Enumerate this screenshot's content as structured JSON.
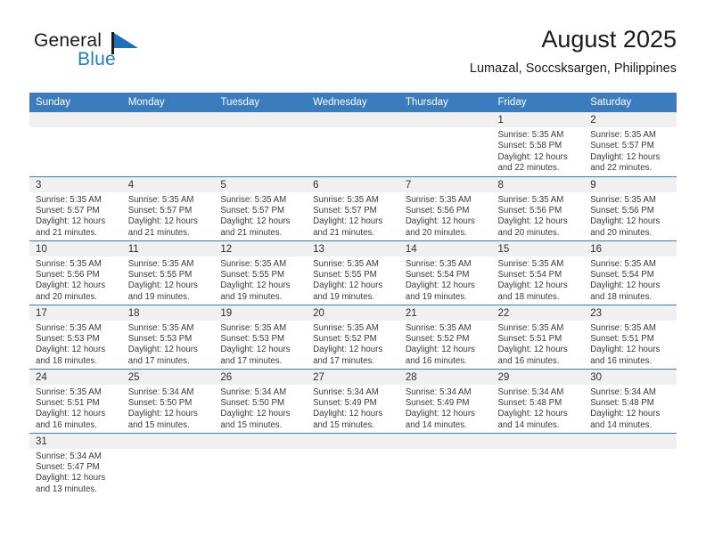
{
  "logo": {
    "word_top": "General",
    "word_bottom": "Blue",
    "flag_icon": "blue-flag-triangle-icon",
    "top_color": "#1a1a1a",
    "bottom_color": "#1d7fc3"
  },
  "header": {
    "title": "August 2025",
    "subtitle": "Lumazal, Soccsksargen, Philippines"
  },
  "theme": {
    "header_blue": "#3a7cbe",
    "daynum_strip": "#f0f0f0",
    "text": "#3a3a3a"
  },
  "weekday_headers": [
    "Sunday",
    "Monday",
    "Tuesday",
    "Wednesday",
    "Thursday",
    "Friday",
    "Saturday"
  ],
  "weeks": [
    [
      {
        "day": "",
        "empty": true
      },
      {
        "day": "",
        "empty": true
      },
      {
        "day": "",
        "empty": true
      },
      {
        "day": "",
        "empty": true
      },
      {
        "day": "",
        "empty": true
      },
      {
        "day": "1",
        "sunrise": "Sunrise: 5:35 AM",
        "sunset": "Sunset: 5:58 PM",
        "daylight_1": "Daylight: 12 hours",
        "daylight_2": "and 22 minutes."
      },
      {
        "day": "2",
        "sunrise": "Sunrise: 5:35 AM",
        "sunset": "Sunset: 5:57 PM",
        "daylight_1": "Daylight: 12 hours",
        "daylight_2": "and 22 minutes."
      }
    ],
    [
      {
        "day": "3",
        "sunrise": "Sunrise: 5:35 AM",
        "sunset": "Sunset: 5:57 PM",
        "daylight_1": "Daylight: 12 hours",
        "daylight_2": "and 21 minutes."
      },
      {
        "day": "4",
        "sunrise": "Sunrise: 5:35 AM",
        "sunset": "Sunset: 5:57 PM",
        "daylight_1": "Daylight: 12 hours",
        "daylight_2": "and 21 minutes."
      },
      {
        "day": "5",
        "sunrise": "Sunrise: 5:35 AM",
        "sunset": "Sunset: 5:57 PM",
        "daylight_1": "Daylight: 12 hours",
        "daylight_2": "and 21 minutes."
      },
      {
        "day": "6",
        "sunrise": "Sunrise: 5:35 AM",
        "sunset": "Sunset: 5:57 PM",
        "daylight_1": "Daylight: 12 hours",
        "daylight_2": "and 21 minutes."
      },
      {
        "day": "7",
        "sunrise": "Sunrise: 5:35 AM",
        "sunset": "Sunset: 5:56 PM",
        "daylight_1": "Daylight: 12 hours",
        "daylight_2": "and 20 minutes."
      },
      {
        "day": "8",
        "sunrise": "Sunrise: 5:35 AM",
        "sunset": "Sunset: 5:56 PM",
        "daylight_1": "Daylight: 12 hours",
        "daylight_2": "and 20 minutes."
      },
      {
        "day": "9",
        "sunrise": "Sunrise: 5:35 AM",
        "sunset": "Sunset: 5:56 PM",
        "daylight_1": "Daylight: 12 hours",
        "daylight_2": "and 20 minutes."
      }
    ],
    [
      {
        "day": "10",
        "sunrise": "Sunrise: 5:35 AM",
        "sunset": "Sunset: 5:56 PM",
        "daylight_1": "Daylight: 12 hours",
        "daylight_2": "and 20 minutes."
      },
      {
        "day": "11",
        "sunrise": "Sunrise: 5:35 AM",
        "sunset": "Sunset: 5:55 PM",
        "daylight_1": "Daylight: 12 hours",
        "daylight_2": "and 19 minutes."
      },
      {
        "day": "12",
        "sunrise": "Sunrise: 5:35 AM",
        "sunset": "Sunset: 5:55 PM",
        "daylight_1": "Daylight: 12 hours",
        "daylight_2": "and 19 minutes."
      },
      {
        "day": "13",
        "sunrise": "Sunrise: 5:35 AM",
        "sunset": "Sunset: 5:55 PM",
        "daylight_1": "Daylight: 12 hours",
        "daylight_2": "and 19 minutes."
      },
      {
        "day": "14",
        "sunrise": "Sunrise: 5:35 AM",
        "sunset": "Sunset: 5:54 PM",
        "daylight_1": "Daylight: 12 hours",
        "daylight_2": "and 19 minutes."
      },
      {
        "day": "15",
        "sunrise": "Sunrise: 5:35 AM",
        "sunset": "Sunset: 5:54 PM",
        "daylight_1": "Daylight: 12 hours",
        "daylight_2": "and 18 minutes."
      },
      {
        "day": "16",
        "sunrise": "Sunrise: 5:35 AM",
        "sunset": "Sunset: 5:54 PM",
        "daylight_1": "Daylight: 12 hours",
        "daylight_2": "and 18 minutes."
      }
    ],
    [
      {
        "day": "17",
        "sunrise": "Sunrise: 5:35 AM",
        "sunset": "Sunset: 5:53 PM",
        "daylight_1": "Daylight: 12 hours",
        "daylight_2": "and 18 minutes."
      },
      {
        "day": "18",
        "sunrise": "Sunrise: 5:35 AM",
        "sunset": "Sunset: 5:53 PM",
        "daylight_1": "Daylight: 12 hours",
        "daylight_2": "and 17 minutes."
      },
      {
        "day": "19",
        "sunrise": "Sunrise: 5:35 AM",
        "sunset": "Sunset: 5:53 PM",
        "daylight_1": "Daylight: 12 hours",
        "daylight_2": "and 17 minutes."
      },
      {
        "day": "20",
        "sunrise": "Sunrise: 5:35 AM",
        "sunset": "Sunset: 5:52 PM",
        "daylight_1": "Daylight: 12 hours",
        "daylight_2": "and 17 minutes."
      },
      {
        "day": "21",
        "sunrise": "Sunrise: 5:35 AM",
        "sunset": "Sunset: 5:52 PM",
        "daylight_1": "Daylight: 12 hours",
        "daylight_2": "and 16 minutes."
      },
      {
        "day": "22",
        "sunrise": "Sunrise: 5:35 AM",
        "sunset": "Sunset: 5:51 PM",
        "daylight_1": "Daylight: 12 hours",
        "daylight_2": "and 16 minutes."
      },
      {
        "day": "23",
        "sunrise": "Sunrise: 5:35 AM",
        "sunset": "Sunset: 5:51 PM",
        "daylight_1": "Daylight: 12 hours",
        "daylight_2": "and 16 minutes."
      }
    ],
    [
      {
        "day": "24",
        "sunrise": "Sunrise: 5:35 AM",
        "sunset": "Sunset: 5:51 PM",
        "daylight_1": "Daylight: 12 hours",
        "daylight_2": "and 16 minutes."
      },
      {
        "day": "25",
        "sunrise": "Sunrise: 5:34 AM",
        "sunset": "Sunset: 5:50 PM",
        "daylight_1": "Daylight: 12 hours",
        "daylight_2": "and 15 minutes."
      },
      {
        "day": "26",
        "sunrise": "Sunrise: 5:34 AM",
        "sunset": "Sunset: 5:50 PM",
        "daylight_1": "Daylight: 12 hours",
        "daylight_2": "and 15 minutes."
      },
      {
        "day": "27",
        "sunrise": "Sunrise: 5:34 AM",
        "sunset": "Sunset: 5:49 PM",
        "daylight_1": "Daylight: 12 hours",
        "daylight_2": "and 15 minutes."
      },
      {
        "day": "28",
        "sunrise": "Sunrise: 5:34 AM",
        "sunset": "Sunset: 5:49 PM",
        "daylight_1": "Daylight: 12 hours",
        "daylight_2": "and 14 minutes."
      },
      {
        "day": "29",
        "sunrise": "Sunrise: 5:34 AM",
        "sunset": "Sunset: 5:48 PM",
        "daylight_1": "Daylight: 12 hours",
        "daylight_2": "and 14 minutes."
      },
      {
        "day": "30",
        "sunrise": "Sunrise: 5:34 AM",
        "sunset": "Sunset: 5:48 PM",
        "daylight_1": "Daylight: 12 hours",
        "daylight_2": "and 14 minutes."
      }
    ],
    [
      {
        "day": "31",
        "sunrise": "Sunrise: 5:34 AM",
        "sunset": "Sunset: 5:47 PM",
        "daylight_1": "Daylight: 12 hours",
        "daylight_2": "and 13 minutes."
      },
      {
        "day": "",
        "empty": true
      },
      {
        "day": "",
        "empty": true
      },
      {
        "day": "",
        "empty": true
      },
      {
        "day": "",
        "empty": true
      },
      {
        "day": "",
        "empty": true
      },
      {
        "day": "",
        "empty": true
      }
    ]
  ]
}
